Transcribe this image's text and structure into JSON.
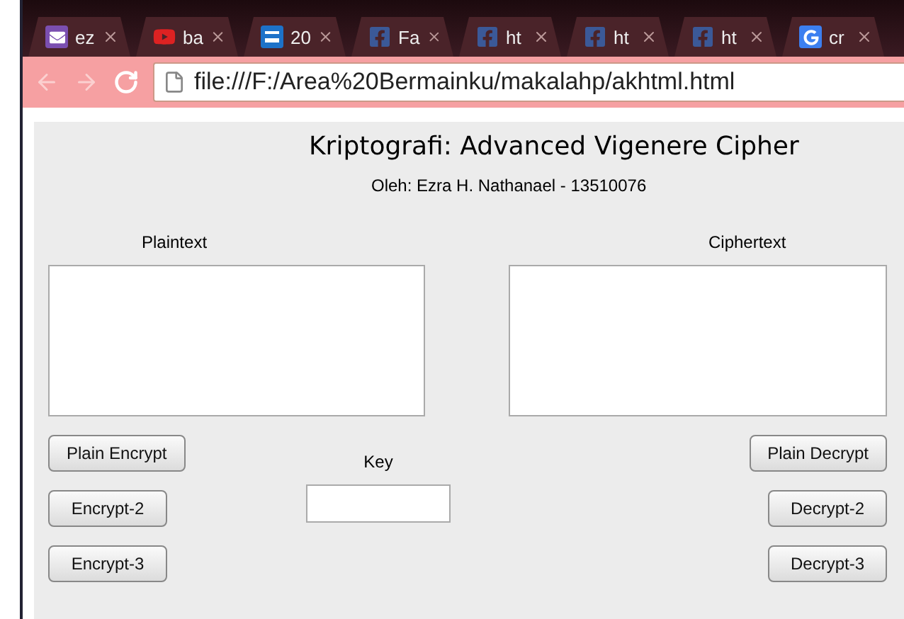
{
  "browser": {
    "tabs": [
      {
        "kind": "mail",
        "label": "ez"
      },
      {
        "kind": "video",
        "label": "ba"
      },
      {
        "kind": "news",
        "label": "20"
      },
      {
        "kind": "facebook",
        "label": "Fa"
      },
      {
        "kind": "facebook",
        "label": "ht"
      },
      {
        "kind": "facebook",
        "label": "ht"
      },
      {
        "kind": "facebook",
        "label": "ht"
      },
      {
        "kind": "google",
        "label": "cr"
      }
    ],
    "address": "file:///F:/Area%20Bermainku/makalahp/akhtml.html"
  },
  "page": {
    "title": "Kriptografi: Advanced Vigenere Cipher",
    "subtitle": "Oleh: Ezra H. Nathanael - 13510076",
    "plaintext_label": "Plaintext",
    "ciphertext_label": "Ciphertext",
    "encrypt_buttons": [
      "Plain Encrypt",
      "Encrypt-2",
      "Encrypt-3"
    ],
    "key_label": "Key",
    "decrypt_buttons": [
      "Plain Decrypt",
      "Decrypt-2",
      "Decrypt-3"
    ]
  }
}
